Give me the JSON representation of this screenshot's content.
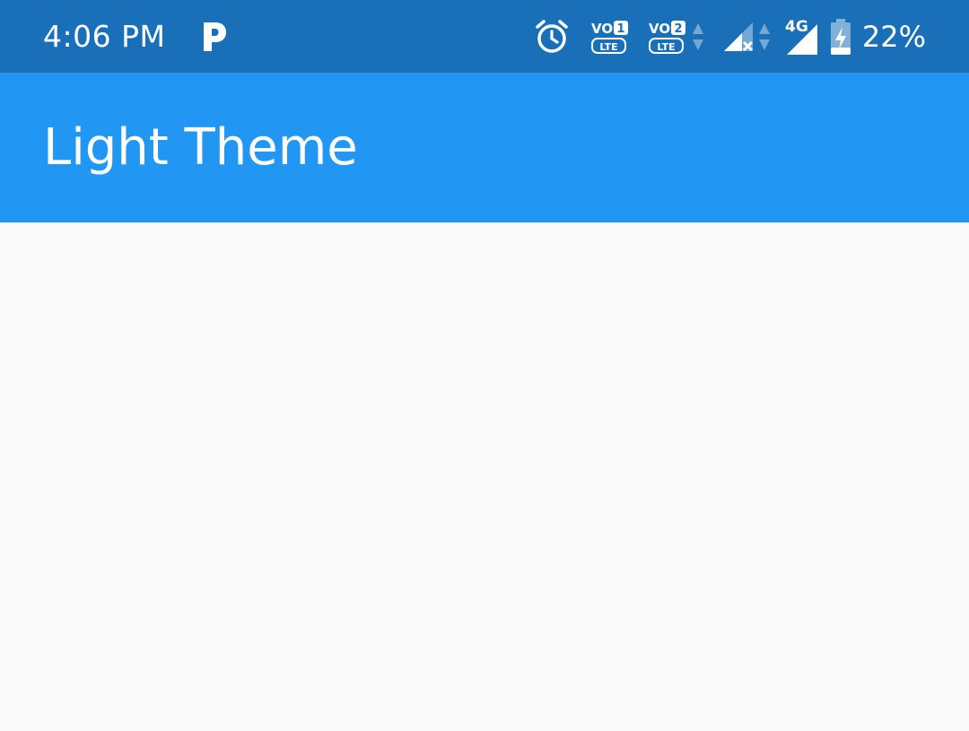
{
  "status_bar": {
    "time": "4:06 PM",
    "notification_icons": [
      "parking-app-icon"
    ],
    "status_icons": [
      "alarm-icon",
      "volte-sim1-icon",
      "volte-sim2-icon",
      "data-arrows-icon",
      "signal-sim1-no-service-icon",
      "data-arrows-icon",
      "signal-sim2-4g-icon",
      "battery-charging-icon"
    ],
    "sim1_badge": "1",
    "sim2_badge": "2",
    "volte_label": "VO",
    "lte_label": "LTE",
    "network_type": "4G",
    "battery_percent": "22%",
    "background_color": "#1A70B8"
  },
  "app_bar": {
    "title": "Light Theme",
    "background_color": "#2196F3",
    "title_color": "#FFFFFF"
  },
  "body": {
    "background_color": "#FAFAFA"
  }
}
